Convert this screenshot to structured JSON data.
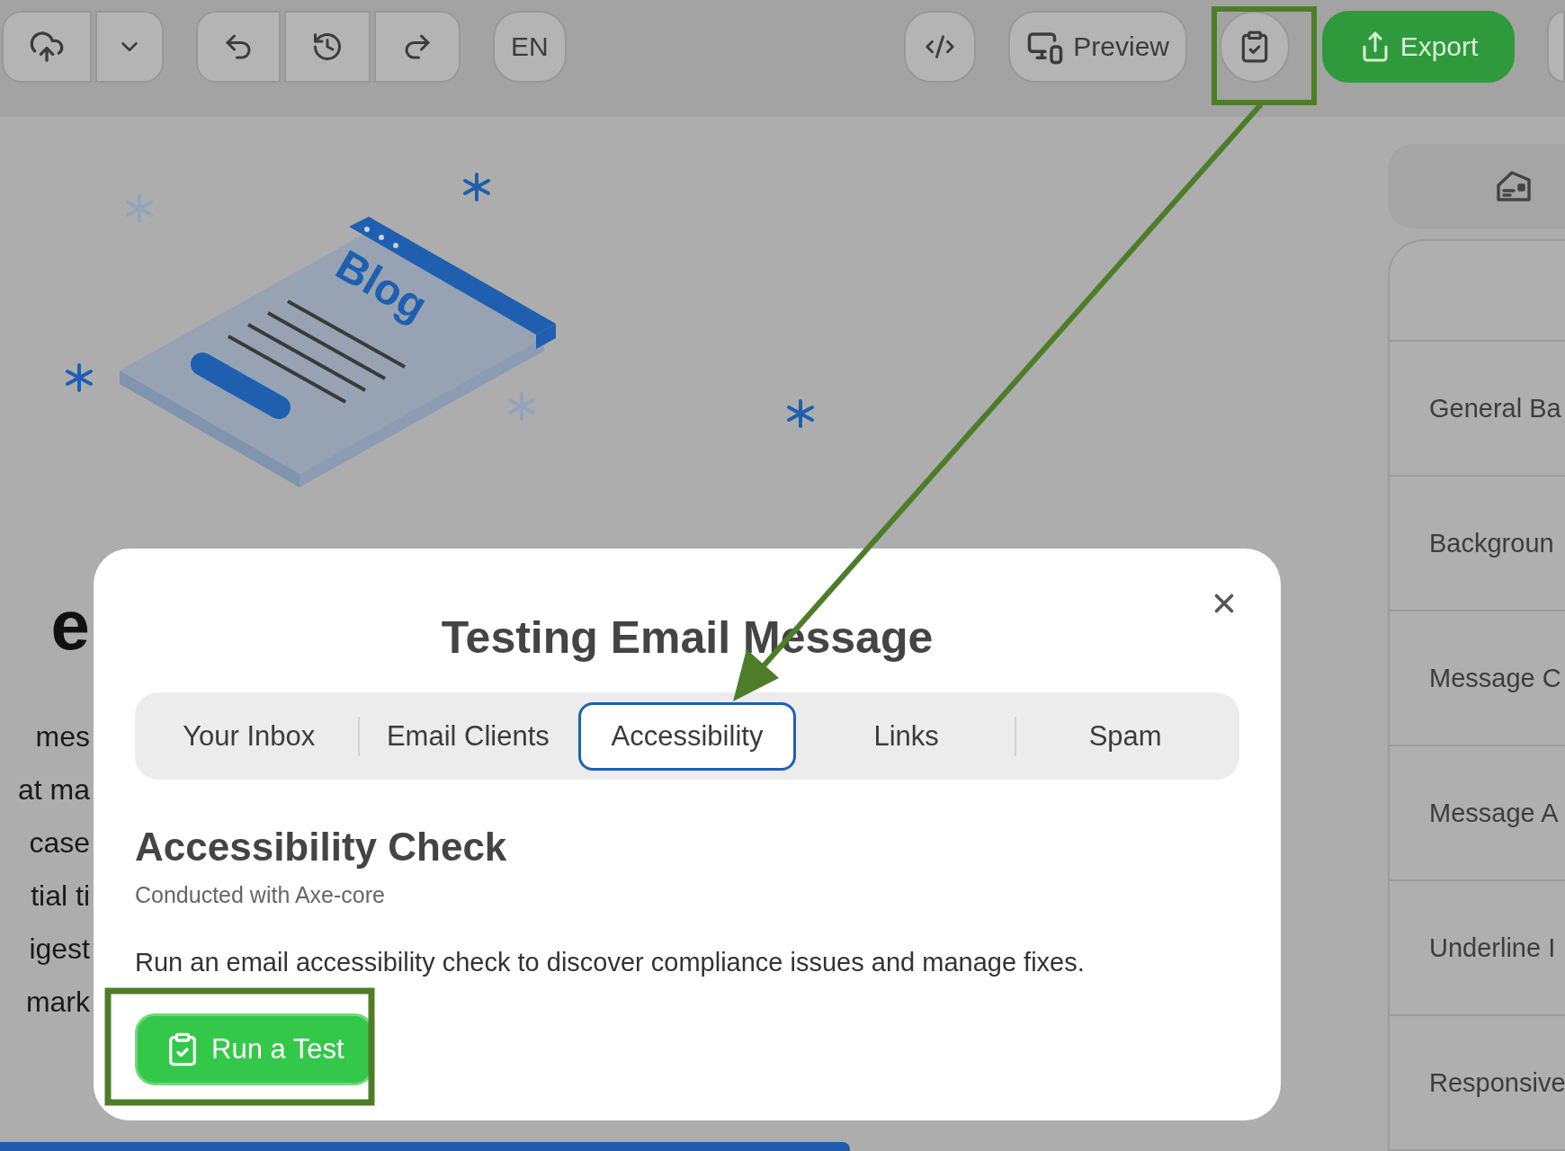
{
  "toolbar": {
    "language": "EN",
    "preview": "Preview",
    "export": "Export"
  },
  "canvas": {
    "illustration_label": "Blog",
    "heading_fragment": "e",
    "text_fragments": [
      "mes",
      "at ma",
      "case",
      "tial ti",
      "igest",
      "mark"
    ]
  },
  "sidebar": {
    "items": [
      "General Ba",
      "Backgroun",
      "Message C",
      "Message A",
      "Underline I",
      "Responsive"
    ]
  },
  "modal": {
    "title": "Testing Email Message",
    "tabs": [
      {
        "label": "Your Inbox",
        "selected": false
      },
      {
        "label": "Email Clients",
        "selected": false
      },
      {
        "label": "Accessibility",
        "selected": true
      },
      {
        "label": "Links",
        "selected": false
      },
      {
        "label": "Spam",
        "selected": false
      }
    ],
    "section_title": "Accessibility Check",
    "section_subtitle": "Conducted with Axe-core",
    "description": "Run an email accessibility check to discover compliance issues and manage fixes.",
    "run_button": "Run a Test"
  }
}
